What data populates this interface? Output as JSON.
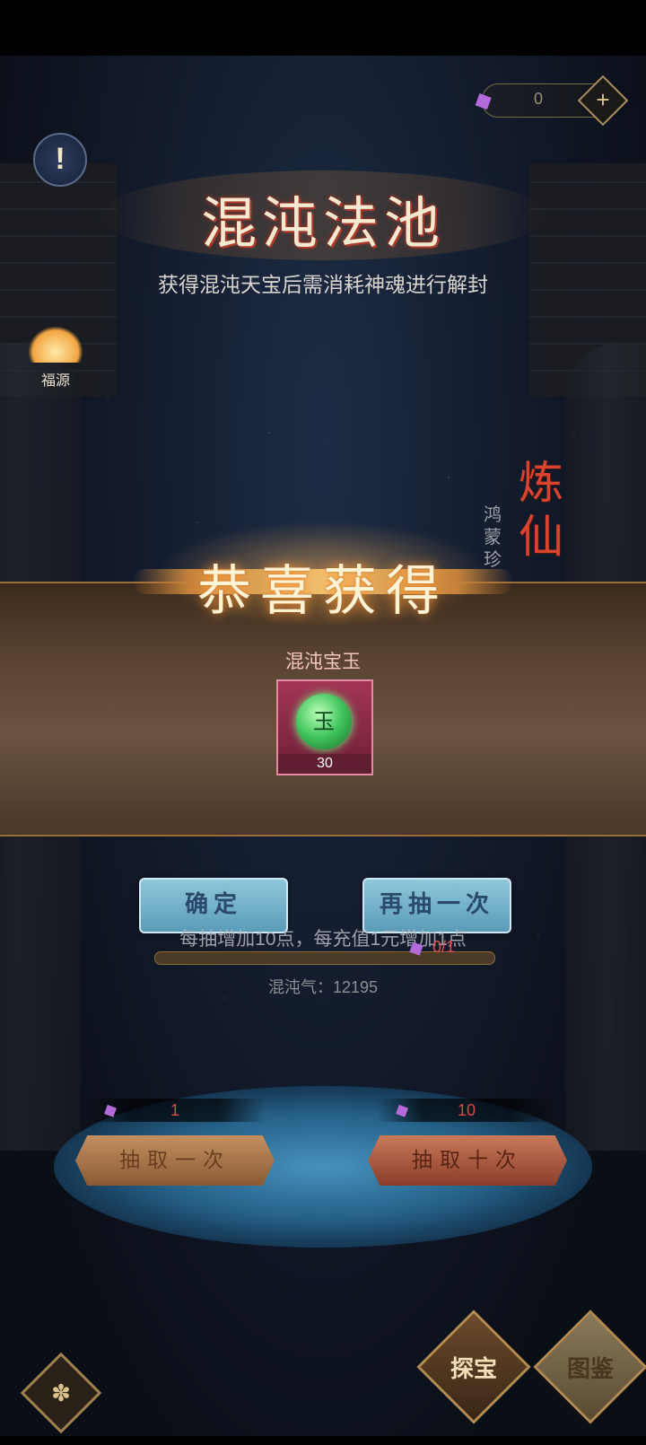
{
  "currency": {
    "icon": "purple-crystal-icon",
    "value": "0",
    "add_label": "+"
  },
  "info": {
    "label": "!"
  },
  "header": {
    "title": "混沌法池",
    "subtitle": "获得混沌天宝后需消耗神魂进行解封"
  },
  "side": {
    "fortune_label": "福源",
    "refine_label": "炼仙",
    "vertical_label": "鸿蒙珍"
  },
  "reward": {
    "title": "恭喜获得",
    "item_name": "混沌宝玉",
    "item_glyph": "玉",
    "item_count": "30"
  },
  "actions": {
    "confirm_label": "确定",
    "again_label": "再抽一次"
  },
  "progress": {
    "hint": "每抽增加10点，每充值1元增加1点",
    "label": "0/1",
    "fraction": 0
  },
  "chaos_qi": {
    "text": "混沌气：12195"
  },
  "draw": {
    "one": {
      "cost": "1",
      "label": "抽取一次"
    },
    "ten": {
      "cost": "10",
      "label": "抽取十次"
    }
  },
  "nav": {
    "explore_label": "探宝",
    "atlas_label": "图鉴",
    "left_icon": "cloud-swirl-icon"
  },
  "colors": {
    "accent_gold": "#d9c28e",
    "title_red": "#b33b2c",
    "confirm_blue": "#5a9bb8",
    "item_border": "#e58aa0"
  }
}
